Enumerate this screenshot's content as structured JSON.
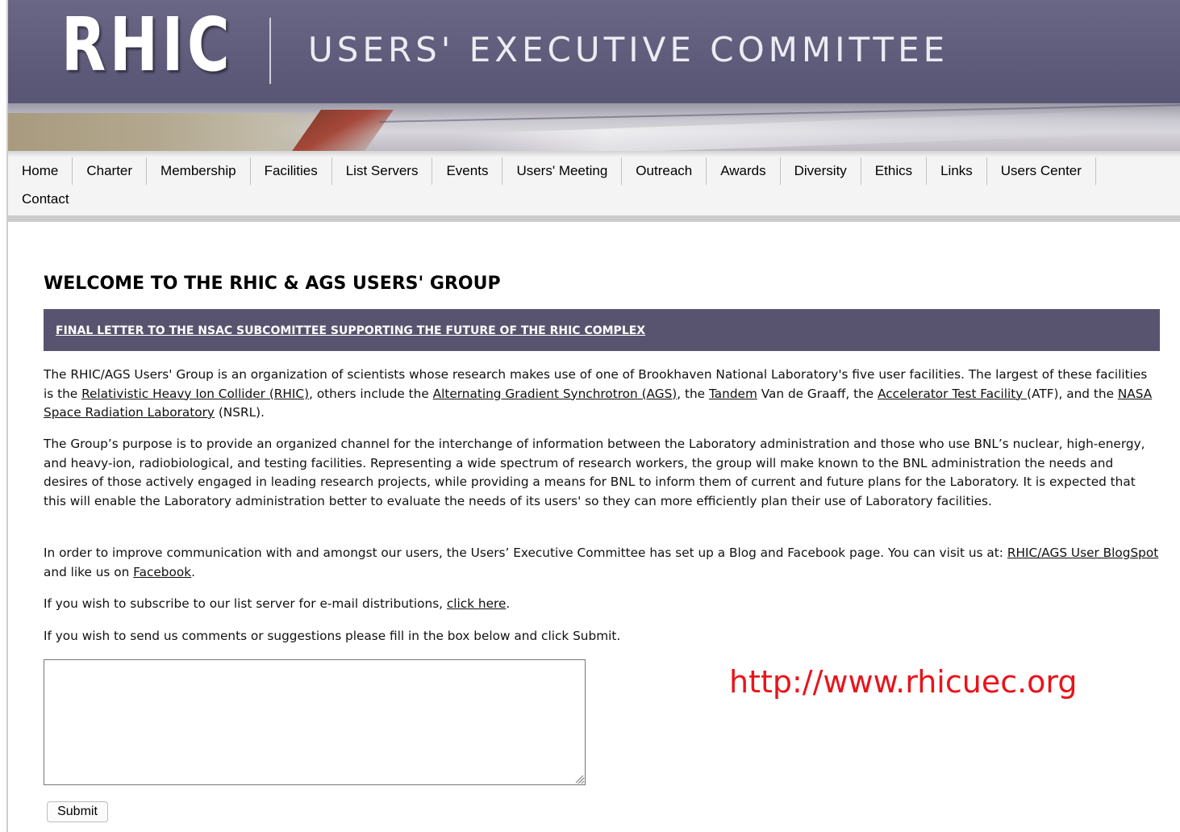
{
  "header": {
    "logo_text": "RHIC",
    "title": "USERS' EXECUTIVE COMMITTEE"
  },
  "nav": {
    "items": [
      "Home",
      "Charter",
      "Membership",
      "Facilities",
      "List Servers",
      "Events",
      "Users' Meeting",
      "Outreach",
      "Awards",
      "Diversity",
      "Ethics",
      "Links",
      "Users Center"
    ],
    "contact": "Contact"
  },
  "main": {
    "heading": "WELCOME TO THE RHIC & AGS USERS' GROUP",
    "notice_link": "FINAL LETTER TO THE NSAC SUBCOMITTEE SUPPORTING THE FUTURE OF THE RHIC COMPLEX",
    "p1": {
      "t1": "The RHIC/AGS Users' Group is an organization of scientists whose research makes use of one of Brookhaven National Laboratory's five user facilities. The largest of these facilities is the ",
      "link_rhic": "Relativistic Heavy Ion Collider (RHIC)",
      "t2": ", others include the ",
      "link_ags": "Alternating Gradient Synchrotron (AGS)",
      "t3": ", the ",
      "link_tandem": "Tandem",
      "t4": " Van de Graaff, the ",
      "link_atf": "Accelerator Test Facility ",
      "t5": "(ATF), and the ",
      "link_nsrl": "NASA Space Radiation Laboratory",
      "t6": " (NSRL)."
    },
    "p2": "The Group’s purpose is to provide an organized channel for the interchange of information between the Laboratory administration and those who use BNL’s nuclear, high-energy, and heavy-ion, radiobiological, and testing facilities. Representing a wide spectrum of research workers, the group will make known to the BNL administration the needs and desires of those actively engaged in leading research projects, while providing a means for BNL to inform them of current and future plans for the Laboratory. It is expected that this will enable the Laboratory administration better to evaluate the needs of its users' so they can more efficiently plan their use of Laboratory facilities.",
    "p3": {
      "t1": "In order to improve communication with and amongst our users, the Users’ Executive Committee has set up a Blog and Facebook page. You can visit us at: ",
      "link_blog": "RHIC/AGS User BlogSpot",
      "t2": " and like us on ",
      "link_facebook": "Facebook",
      "t3": "."
    },
    "p4": {
      "t1": "If you wish to subscribe to our list server for e-mail distributions, ",
      "link_click": "click here",
      "t2": "."
    },
    "p5": "If you wish to send us comments or suggestions please fill in the box below and click Submit.",
    "comment_value": "",
    "submit_label": "Submit"
  },
  "overlay": {
    "url_text": "http://www.rhicuec.org",
    "color": "#e8141b"
  },
  "colors": {
    "banner": "#5b5777",
    "notice_bar": "#58546f",
    "nav_bg": "#f4f4f4"
  }
}
